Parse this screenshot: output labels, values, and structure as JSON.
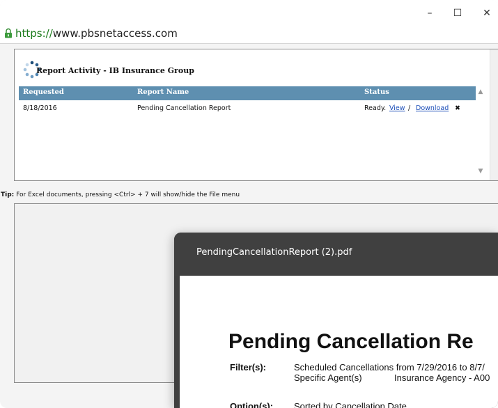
{
  "browser": {
    "url_scheme": "https://",
    "url_host": "www.pbsnetaccess.com",
    "minimize_glyph": "–",
    "maximize_glyph": "☐",
    "close_glyph": "✕",
    "lock_icon": "lock-icon"
  },
  "report_activity": {
    "title": "Report Activity - IB Insurance Group",
    "columns": [
      "Requested",
      "Report Name",
      "Status"
    ],
    "rows": [
      {
        "requested": "8/18/2016",
        "report_name": "Pending Cancellation Report",
        "status": "Ready.",
        "view_label": "View",
        "separator": "/",
        "download_label": "Download",
        "delete_glyph": "✖"
      }
    ]
  },
  "tip": {
    "label": "Tip:",
    "text": "For Excel documents, pressing <Ctrl> + 7 will show/hide the File menu"
  },
  "pdf_viewer": {
    "filename": "PendingCancellationReport (2).pdf",
    "document": {
      "title": "Pending Cancellation Re",
      "filter_label": "Filter(s):",
      "filter_line1": "Scheduled Cancellations from 7/29/2016 to 8/7/",
      "filter_line2a": "Specific Agent(s)",
      "filter_line2b": "Insurance Agency - A00",
      "option_label": "Option(s):",
      "option_value": "Sorted by Cancellation Date"
    }
  },
  "colors": {
    "table_header": "#5e8fb0",
    "link": "#1a4db8",
    "pdf_titlebar": "#404040",
    "secure_scheme": "#1a7a1a"
  }
}
